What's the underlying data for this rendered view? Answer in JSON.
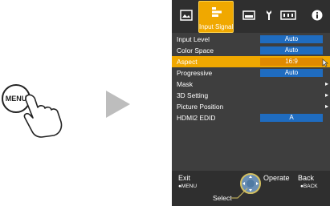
{
  "illustration": {
    "button_label": "MENU"
  },
  "tabs": {
    "active_label": "Input Signal",
    "icons": [
      "picture-icon",
      "input-signal-icon",
      "installation-icon",
      "function-icon",
      "display-setup-icon",
      "info-icon"
    ]
  },
  "menu": {
    "items": [
      {
        "label": "Input Level",
        "value": "Auto"
      },
      {
        "label": "Color Space",
        "value": "Auto"
      },
      {
        "label": "Aspect",
        "value": "16:9",
        "selected": true
      },
      {
        "label": "Progressive",
        "value": "Auto"
      },
      {
        "label": "Mask",
        "submenu": "▸"
      },
      {
        "label": "3D Setting",
        "submenu": "▸"
      },
      {
        "label": "Picture Position",
        "submenu": "▸"
      },
      {
        "label": "HDMI2 EDID",
        "value": "A"
      }
    ]
  },
  "bottom": {
    "exit_label": "Exit",
    "exit_sub": "●MENU",
    "select_label": "Select",
    "operate_label": "Operate",
    "back_label": "Back",
    "back_sub": "●BACK"
  },
  "colors": {
    "accent": "#f0a800",
    "value_box": "#1f6cc0",
    "panel": "#3e3e3e"
  }
}
